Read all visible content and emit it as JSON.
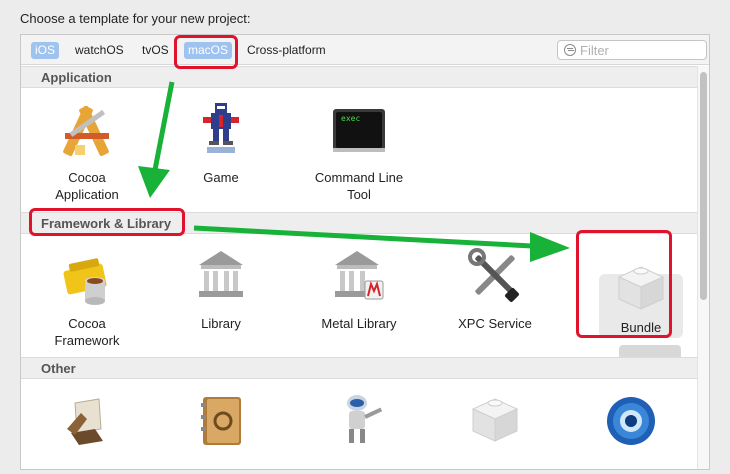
{
  "title": "Choose a template for your new project:",
  "tabs": [
    {
      "label": "iOS"
    },
    {
      "label": "watchOS"
    },
    {
      "label": "tvOS"
    },
    {
      "label": "macOS"
    },
    {
      "label": "Cross-platform"
    }
  ],
  "filter": {
    "placeholder": "Filter"
  },
  "sections": [
    {
      "title": "Application",
      "items": [
        {
          "label": "Cocoa\nApplication",
          "icon": "cocoa-app-icon"
        },
        {
          "label": "Game",
          "icon": "game-icon"
        },
        {
          "label": "Command Line\nTool",
          "icon": "terminal-icon",
          "icon_text": "exec"
        }
      ]
    },
    {
      "title": "Framework & Library",
      "items": [
        {
          "label": "Cocoa\nFramework",
          "icon": "cocoa-framework-icon"
        },
        {
          "label": "Library",
          "icon": "library-icon"
        },
        {
          "label": "Metal Library",
          "icon": "metal-library-icon"
        },
        {
          "label": "XPC Service",
          "icon": "xpc-service-icon"
        },
        {
          "label": "Bundle",
          "icon": "bundle-icon",
          "selected": true
        }
      ]
    },
    {
      "title": "Other",
      "items": [
        {
          "icon": "applescript-icon"
        },
        {
          "icon": "address-book-icon"
        },
        {
          "icon": "automator-icon"
        },
        {
          "icon": "generic-bundle-icon"
        },
        {
          "icon": "quick-look-icon"
        }
      ]
    }
  ],
  "colors": {
    "annotation_red": "#e0122c",
    "annotation_green": "#19b239",
    "tab_selected": "#9ec3ee"
  }
}
